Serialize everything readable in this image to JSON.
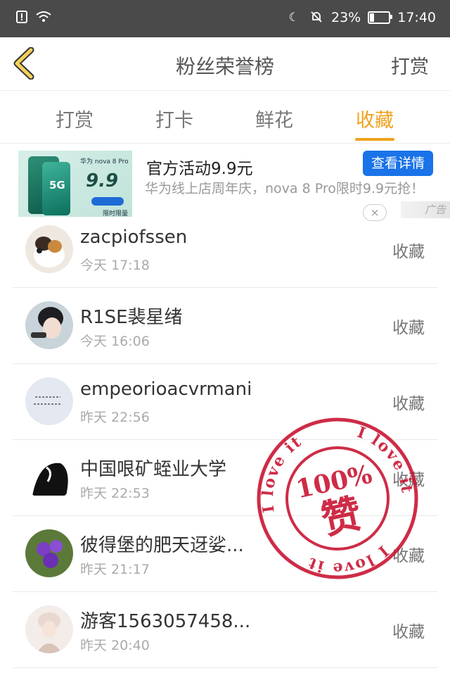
{
  "status_bar": {
    "left_icons": [
      "alert-icon",
      "wifi-icon"
    ],
    "battery_percent": "23%",
    "battery_level": 0.23,
    "time": "17:40"
  },
  "header": {
    "title": "粉丝荣誉榜",
    "action_label": "打赏"
  },
  "tabs": [
    {
      "label": "打赏",
      "active": false
    },
    {
      "label": "打卡",
      "active": false
    },
    {
      "label": "鲜花",
      "active": false
    },
    {
      "label": "收藏",
      "active": true
    }
  ],
  "ad": {
    "image_brand": "华为 nova 8 Pro",
    "image_5g": "5G",
    "image_price": "9.9",
    "image_tag": "限时限量",
    "title": "官方活动9.9元",
    "description": "华为线上店周年庆，nova 8 Pro限时9.9元抢！",
    "detail_button": "查看详情",
    "close": "×",
    "label": "广告"
  },
  "list": [
    {
      "name": "zacpiofssen",
      "time": "今天 17:18",
      "action": "收藏"
    },
    {
      "name": "R1SE裴星绪",
      "time": "今天 16:06",
      "action": "收藏"
    },
    {
      "name": "empeorioacvrmani",
      "time": "昨天 22:56",
      "action": "收藏"
    },
    {
      "name": "中国哏矿蛭业大学",
      "time": "昨天 22:53",
      "action": "收藏"
    },
    {
      "name": "彼得堡的肥天迓娑...",
      "time": "昨天 21:17",
      "action": "收藏"
    },
    {
      "name": "游客1563057458...",
      "time": "昨天 20:40",
      "action": "收藏"
    }
  ],
  "stamp": {
    "ring_text": "I love it",
    "percent": "100%",
    "center_text": "赞",
    "color": "#c8102e"
  },
  "colors": {
    "accent": "#f0a31c",
    "status_bar": "#4a4a4a",
    "ad_button": "#1a73e8"
  }
}
